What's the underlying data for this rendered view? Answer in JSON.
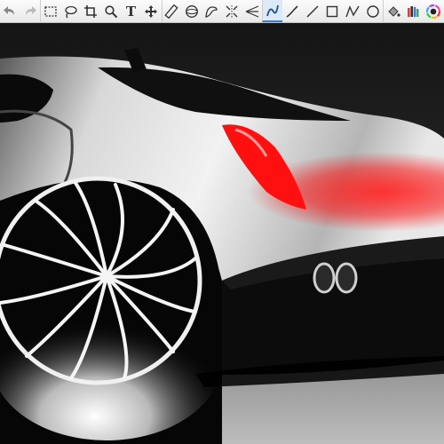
{
  "toolbar": {
    "tools": [
      {
        "name": "undo-icon"
      },
      {
        "name": "redo-icon"
      },
      {
        "name": "rect-select-icon"
      },
      {
        "name": "lasso-select-icon"
      },
      {
        "name": "crop-icon"
      },
      {
        "name": "zoom-icon"
      },
      {
        "name": "text-icon",
        "glyph": "T"
      },
      {
        "name": "move-icon"
      },
      {
        "name": "ruler-icon"
      },
      {
        "name": "ellipse-guide-icon"
      },
      {
        "name": "french-curve-icon"
      },
      {
        "name": "symmetry-icon"
      },
      {
        "name": "perspective-icon"
      },
      {
        "name": "stroke-icon",
        "active": true
      },
      {
        "name": "pencil-icon"
      },
      {
        "name": "line-icon"
      },
      {
        "name": "rectangle-icon"
      },
      {
        "name": "polyline-icon"
      },
      {
        "name": "circle-icon"
      },
      {
        "name": "fill-bucket-icon"
      },
      {
        "name": "brush-library-icon"
      },
      {
        "name": "color-wheel-icon"
      }
    ],
    "accent_color": "#3a7bd5"
  },
  "canvas": {
    "subject": "car-sketch",
    "colors": {
      "background": "#2a2a2a",
      "taillight": "#ff1010",
      "body": "#d9d9d9"
    }
  }
}
